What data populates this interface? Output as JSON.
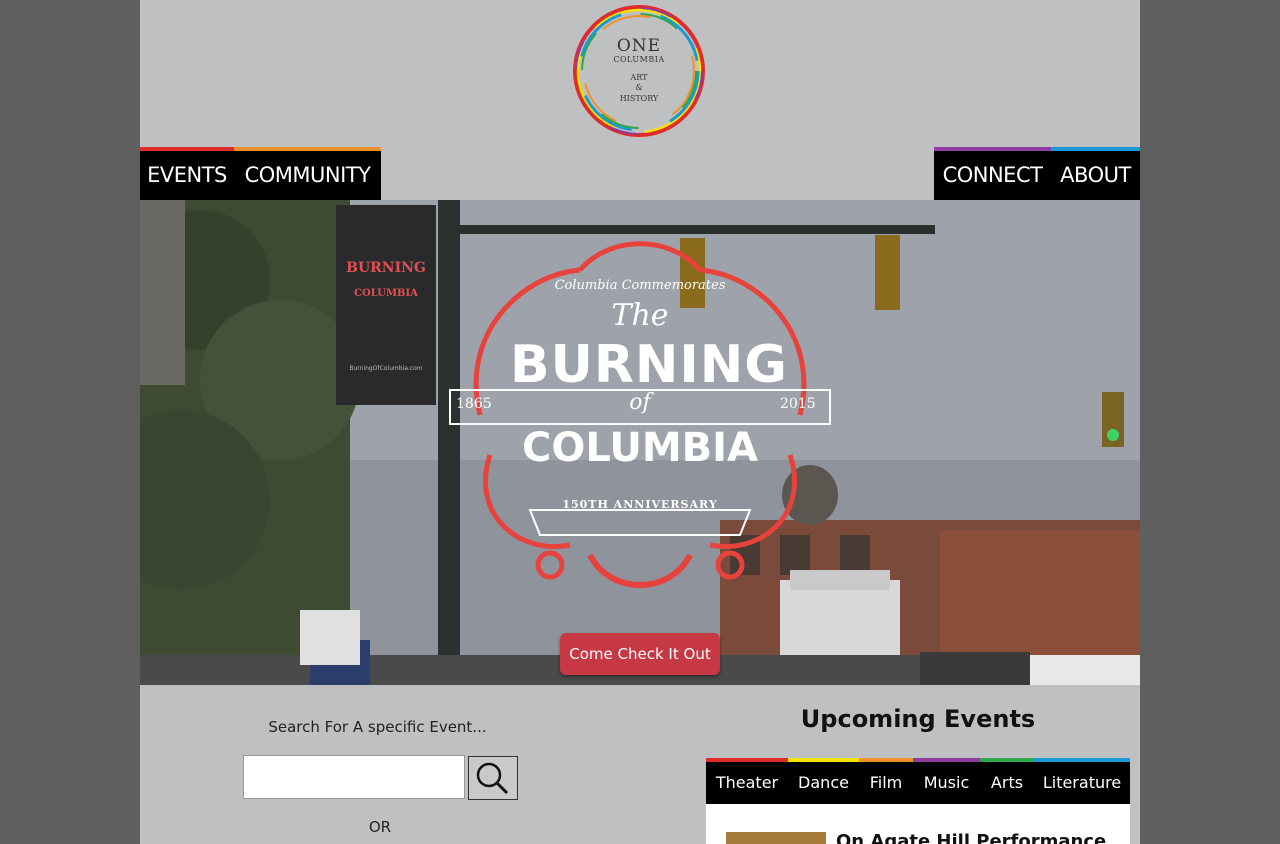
{
  "logo": {
    "line1": "ONE",
    "line2": "COLUMBIA",
    "line3": "ART",
    "line4": "&",
    "line5": "HISTORY"
  },
  "nav": {
    "left": [
      {
        "label": "EVENTS",
        "color": "#e02b2b"
      },
      {
        "label": "COMMUNITY",
        "color": "#f0902a"
      }
    ],
    "right": [
      {
        "label": "CONNECT",
        "color": "#8e3ba3"
      },
      {
        "label": "ABOUT",
        "color": "#1b9ad6"
      }
    ]
  },
  "hero": {
    "banner_title": "BURNING",
    "banner_sub": "COLUMBIA",
    "banner_small": "BurningOfColumbia.com",
    "emblem_arc": "Columbia Commemorates",
    "emblem_the": "The",
    "emblem_burning": "BURNING",
    "emblem_of": "of",
    "emblem_columbia": "COLUMBIA",
    "year_left": "1865",
    "year_right": "2015",
    "anniversary": "150TH ANNIVERSARY",
    "cta_label": "Come Check It Out"
  },
  "search": {
    "label": "Search For A specific Event...",
    "value": "",
    "placeholder": "",
    "or_label": "OR"
  },
  "upcoming": {
    "title": "Upcoming Events",
    "categories": [
      {
        "label": "Theater",
        "color": "#e02b2b"
      },
      {
        "label": "Dance",
        "color": "#f5e400"
      },
      {
        "label": "Film",
        "color": "#f0902a"
      },
      {
        "label": "Music",
        "color": "#8e3ba3"
      },
      {
        "label": "Arts",
        "color": "#2ea84a"
      },
      {
        "label": "Literature",
        "color": "#1b9ad6"
      }
    ],
    "first_event_title": "On Agate Hill Performance"
  },
  "colors": {
    "page_bg": "#bfc0c2",
    "outer_bg": "#5f5f5f",
    "cta_bg": "#c63944",
    "emblem_red": "#e8423c"
  }
}
